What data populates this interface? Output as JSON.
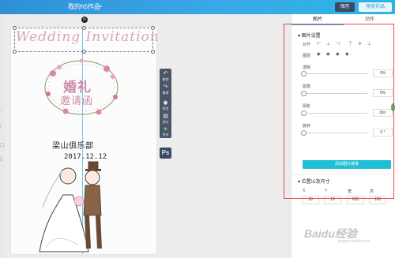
{
  "topbar": {
    "title": "我的h5作品",
    "save_label": "保存",
    "preview_label": "预览作品"
  },
  "canvas": {
    "invite_title": "Wedding  Invitation",
    "cn_title_line1": "婚礼",
    "cn_title_line2": "邀请函",
    "venue": "梁山俱乐部",
    "date": "2017.12.12"
  },
  "float_toolbar": {
    "items": [
      {
        "icon": "undo-icon",
        "label": "撤销"
      },
      {
        "icon": "redo-icon",
        "label": "重做"
      },
      {
        "icon": "eye-icon",
        "label": "预览"
      },
      {
        "icon": "save-icon",
        "label": "保存"
      },
      {
        "icon": "publish-icon",
        "label": "发布"
      }
    ],
    "ps_label": "Ps"
  },
  "panel": {
    "tabs": [
      "图片",
      "动作"
    ],
    "image_settings_title": "▾ 图片设置",
    "align_label": "对齐",
    "layer_label": "图层",
    "opacity_label": "透明",
    "opacity_value": "0%",
    "radius_label": "圆角",
    "radius_value": "0%",
    "shadow_label": "阴影",
    "shadow_value": "0px",
    "rotate_label": "旋转",
    "rotate_value": "0 °",
    "add_link_label": "添加图片链接",
    "position_title": "▾ 位置以及尺寸",
    "pos_labels": [
      "X",
      "Y",
      "宽",
      "高"
    ],
    "pos_values": [
      "18",
      "19",
      "605",
      "100"
    ]
  },
  "watermark": {
    "text": "Baidu经验",
    "sub": "jingyan.baidu.com"
  },
  "colors": {
    "topbar": "#2f8fd6",
    "accent": "#1fc0d6",
    "highlight": "#e34b4b"
  }
}
